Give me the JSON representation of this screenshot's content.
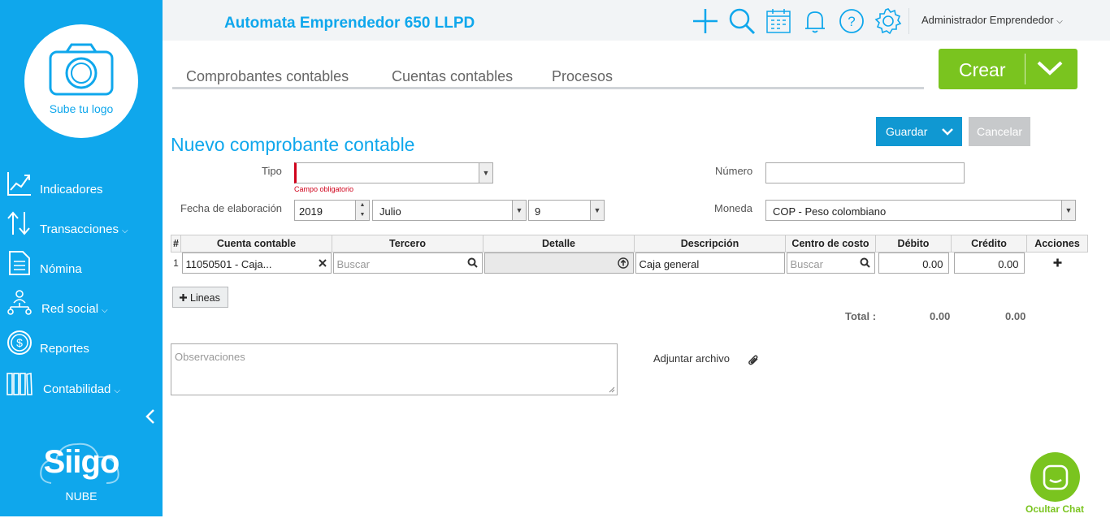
{
  "app": {
    "title": "Automata Emprendedor 650 LLPD",
    "user": "Administrador Emprendedor",
    "accent": "#0fa7ec",
    "green": "#7ac41f"
  },
  "sidebar": {
    "logo_text": "Sube tu logo",
    "items": [
      {
        "label": "Indicadores",
        "icon": "chart-line-icon",
        "has_chevron": false
      },
      {
        "label": "Transacciones",
        "icon": "exchange-arrows-icon",
        "has_chevron": true
      },
      {
        "label": "Nómina",
        "icon": "document-icon",
        "has_chevron": false
      },
      {
        "label": "Red social",
        "icon": "network-icon",
        "has_chevron": true
      },
      {
        "label": "Reportes",
        "icon": "dollar-coin-icon",
        "has_chevron": false
      },
      {
        "label": "Contabilidad",
        "icon": "books-icon",
        "has_chevron": true
      }
    ],
    "brand": "Siigo",
    "brand_sub": "NUBE"
  },
  "topbar": {
    "icons": [
      "plus-icon",
      "search-icon",
      "calendar-icon",
      "bell-icon",
      "help-icon",
      "gear-icon"
    ]
  },
  "tabs": [
    "Comprobantes contables",
    "Cuentas contables",
    "Procesos"
  ],
  "crear_label": "Crear",
  "form": {
    "title": "Nuevo comprobante contable",
    "guardar": "Guardar",
    "cancelar": "Cancelar",
    "tipo_label": "Tipo",
    "tipo_value": "",
    "tipo_error": "Campo obligatorio",
    "numero_label": "Número",
    "numero_value": "",
    "fecha_label": "Fecha de elaboración",
    "year": "2019",
    "month": "Julio",
    "day": "9",
    "moneda_label": "Moneda",
    "moneda_value": "COP - Peso colombiano"
  },
  "table": {
    "headers": [
      "#",
      "Cuenta contable",
      "Tercero",
      "Detalle",
      "Descripción",
      "Centro de costo",
      "Débito",
      "Crédito",
      "Acciones"
    ],
    "rows": [
      {
        "num": "1",
        "cuenta": "11050501 - Caja...",
        "tercero_placeholder": "Buscar",
        "detalle": "",
        "descripcion": "Caja general",
        "centro_placeholder": "Buscar",
        "debito": "0.00",
        "credito": "0.00"
      }
    ]
  },
  "lineas_label": "Lineas",
  "totals": {
    "label": "Total :",
    "debito": "0.00",
    "credito": "0.00"
  },
  "observaciones_placeholder": "Observaciones",
  "adjuntar_label": "Adjuntar archivo",
  "chat_label": "Ocultar Chat"
}
